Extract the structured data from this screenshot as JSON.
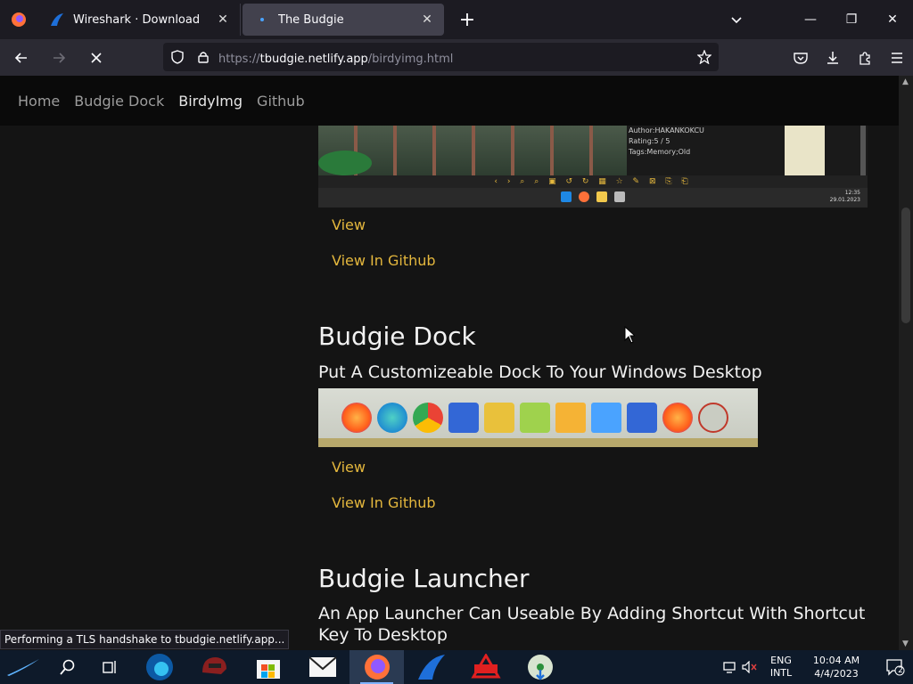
{
  "browser": {
    "tabs": [
      {
        "title": "Wireshark · Download",
        "active": false
      },
      {
        "title": "The Budgie",
        "active": true
      }
    ],
    "url": {
      "prefix": "https://",
      "host": "tbudgie.netlify.app",
      "path": "/birdyimg.html"
    }
  },
  "site_nav": {
    "items": [
      "Home",
      "Budgie Dock",
      "BirdyImg",
      "Github"
    ],
    "active": "BirdyImg"
  },
  "birdyimg_preview": {
    "meta": [
      "Author:HAKANKOKCU",
      "Rating:5 / 5",
      "Tags:Memory;Old"
    ],
    "toolbar": "‹ › ⌕ ⌕ ▣ ↺ ↻ ▦ ☆ ✎ ⊠ ⎘ ⎗",
    "clock": [
      "12:35",
      "29.01.2023"
    ]
  },
  "sections": [
    {
      "view": "View",
      "github": "View In Github"
    },
    {
      "title": "Budgie Dock",
      "subtitle": "Put A Customizeable Dock To Your Windows Desktop",
      "view": "View",
      "github": "View In Github"
    },
    {
      "title": "Budgie Launcher",
      "subtitle": "An App Launcher Can Useable By Adding Shortcut With Shortcut Key To Desktop"
    }
  ],
  "status_text": "Performing a TLS handshake to tbudgie.netlify.app...",
  "taskbar": {
    "language": [
      "ENG",
      "INTL"
    ],
    "time": "10:04 AM",
    "date": "4/4/2023",
    "notification_count": "2"
  },
  "colors": {
    "accent_link": "#e4b73d",
    "page_bg": "#141414",
    "browser_chrome": "#1c1b22"
  }
}
